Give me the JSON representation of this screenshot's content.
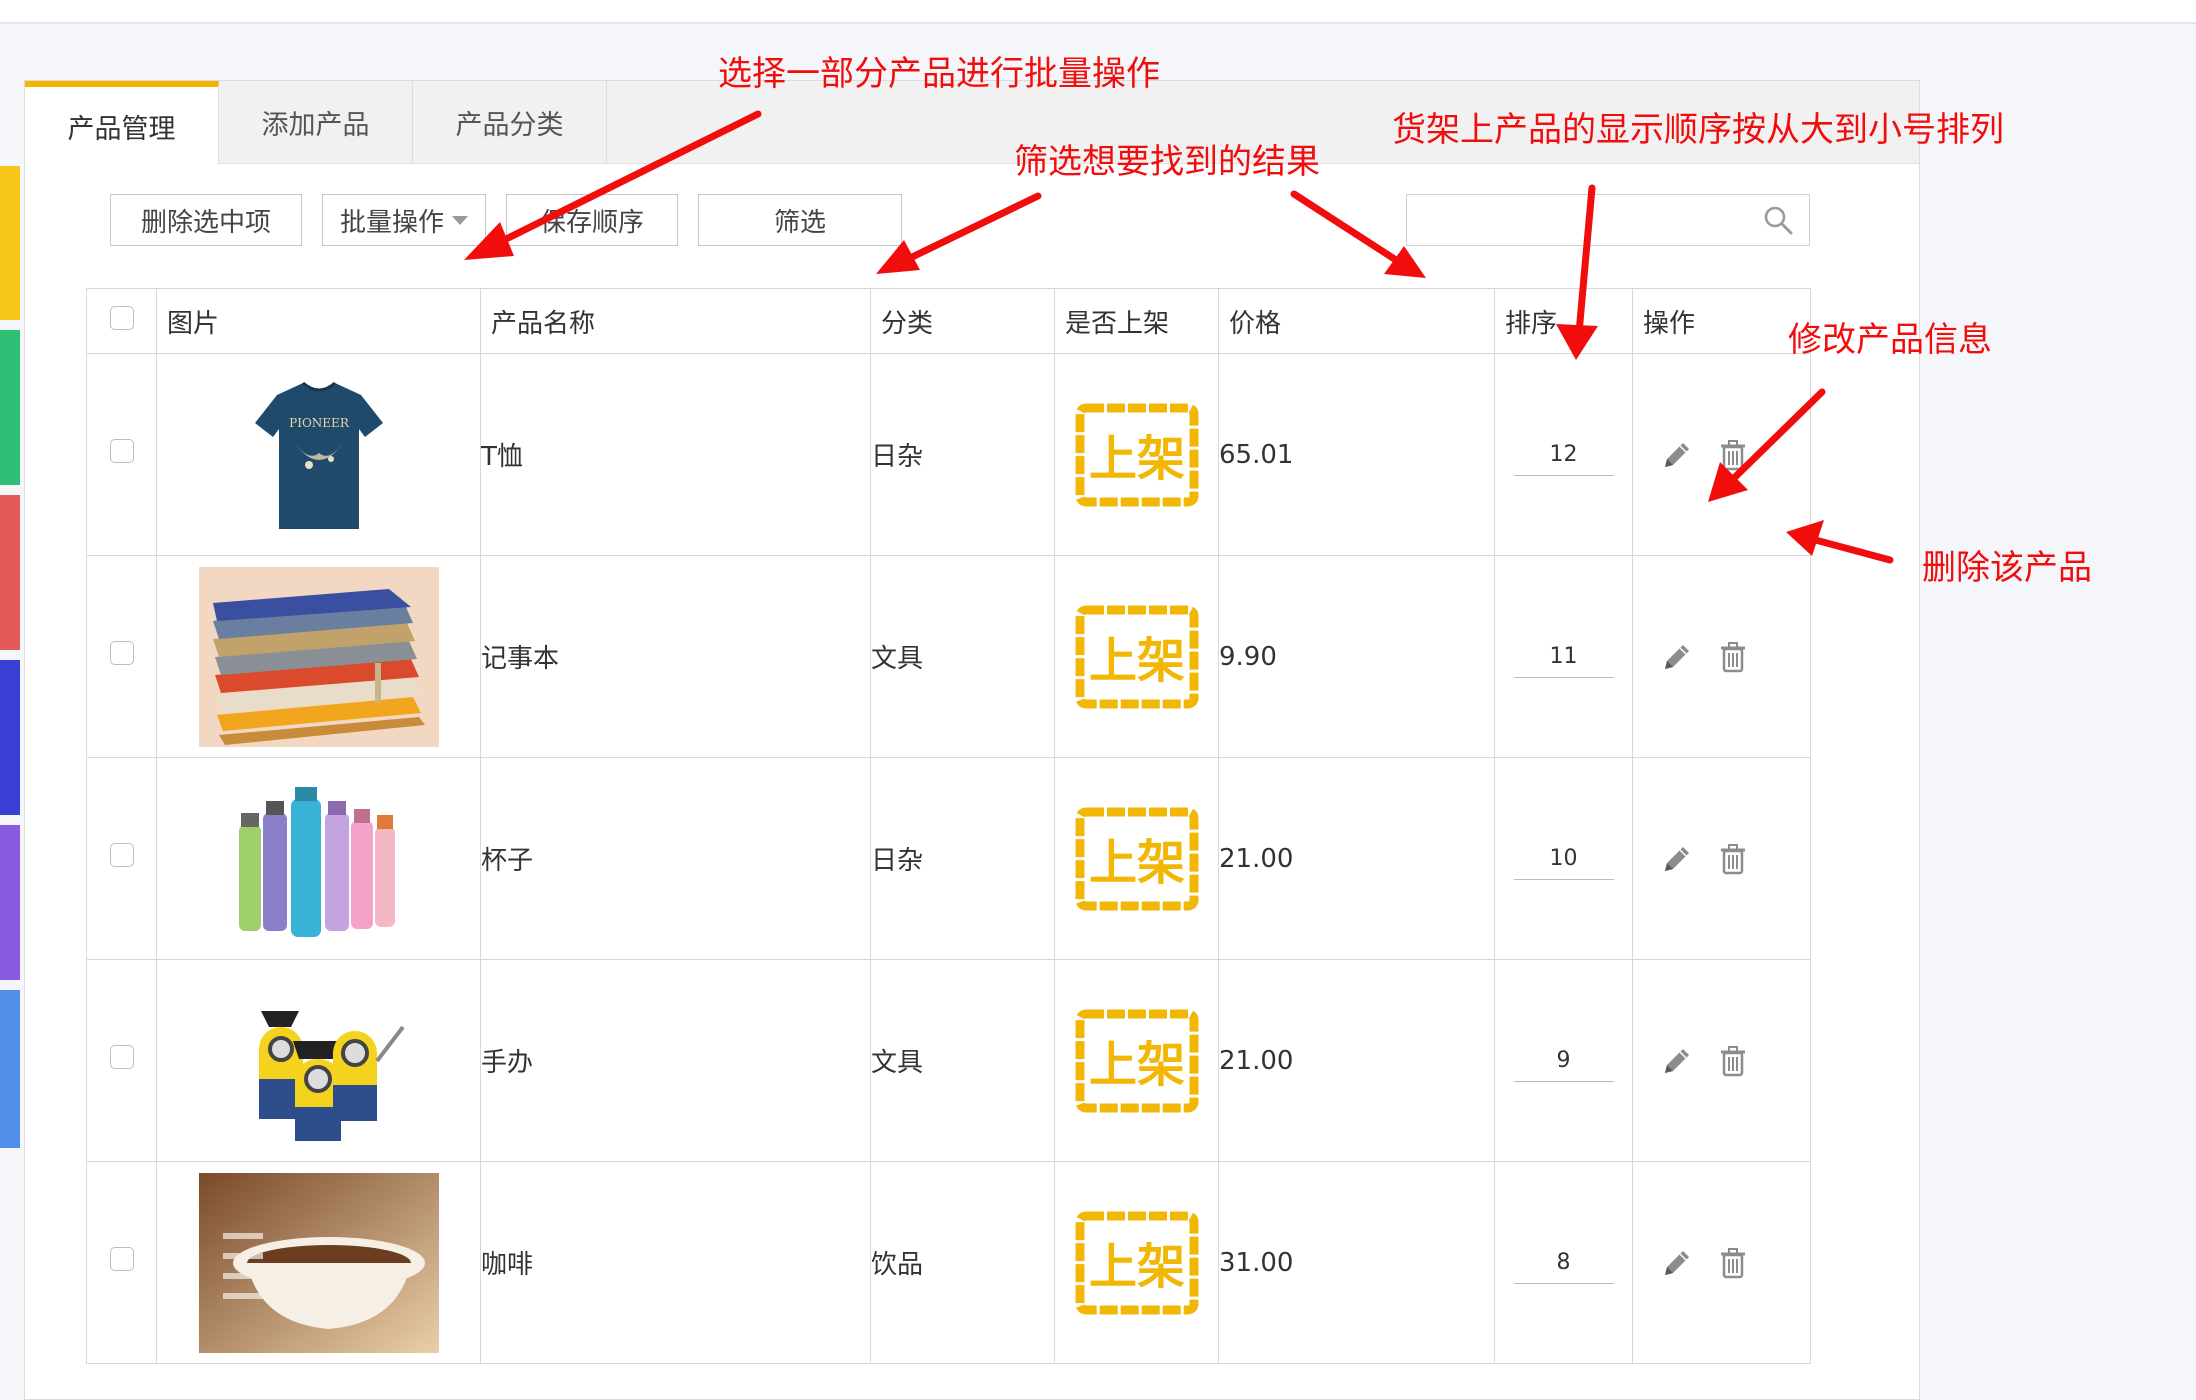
{
  "tabs": [
    {
      "label": "产品管理",
      "active": true
    },
    {
      "label": "添加产品",
      "active": false
    },
    {
      "label": "产品分类",
      "active": false
    }
  ],
  "toolbar": {
    "delete_selected": "删除选中项",
    "batch_ops": "批量操作",
    "save_order": "保存顺序",
    "filter": "筛选"
  },
  "search": {
    "value": "",
    "placeholder": ""
  },
  "table": {
    "columns": [
      "图片",
      "产品名称",
      "分类",
      "是否上架",
      "价格",
      "排序",
      "操作"
    ],
    "rows": [
      {
        "name": "T恤",
        "category": "日杂",
        "status": "上架",
        "price": "65.01",
        "order": "12",
        "image": "tshirt"
      },
      {
        "name": "记事本",
        "category": "文具",
        "status": "上架",
        "price": "9.90",
        "order": "11",
        "image": "notebook"
      },
      {
        "name": "杯子",
        "category": "日杂",
        "status": "上架",
        "price": "21.00",
        "order": "10",
        "image": "bottles"
      },
      {
        "name": "手办",
        "category": "文具",
        "status": "上架",
        "price": "21.00",
        "order": "9",
        "image": "minions"
      },
      {
        "name": "咖啡",
        "category": "饮品",
        "status": "上架",
        "price": "31.00",
        "order": "8",
        "image": "coffee"
      }
    ]
  },
  "tshirt_brand": "PIONEER",
  "annotations": {
    "batch": "选择一部分产品进行批量操作",
    "filter": "筛选想要找到的结果",
    "order": "货架上产品的显示顺序按从大到小号排列",
    "edit": "修改产品信息",
    "delete": "删除该产品"
  },
  "colors": {
    "accent_tab": "#f5b400",
    "stamp": "#f2b705",
    "annotation": "#f20d0d",
    "side_strip": [
      "#f5c518",
      "#2dbf74",
      "#e45a5a",
      "#3a3fd4",
      "#8a5be0",
      "#4f8fe8"
    ]
  }
}
